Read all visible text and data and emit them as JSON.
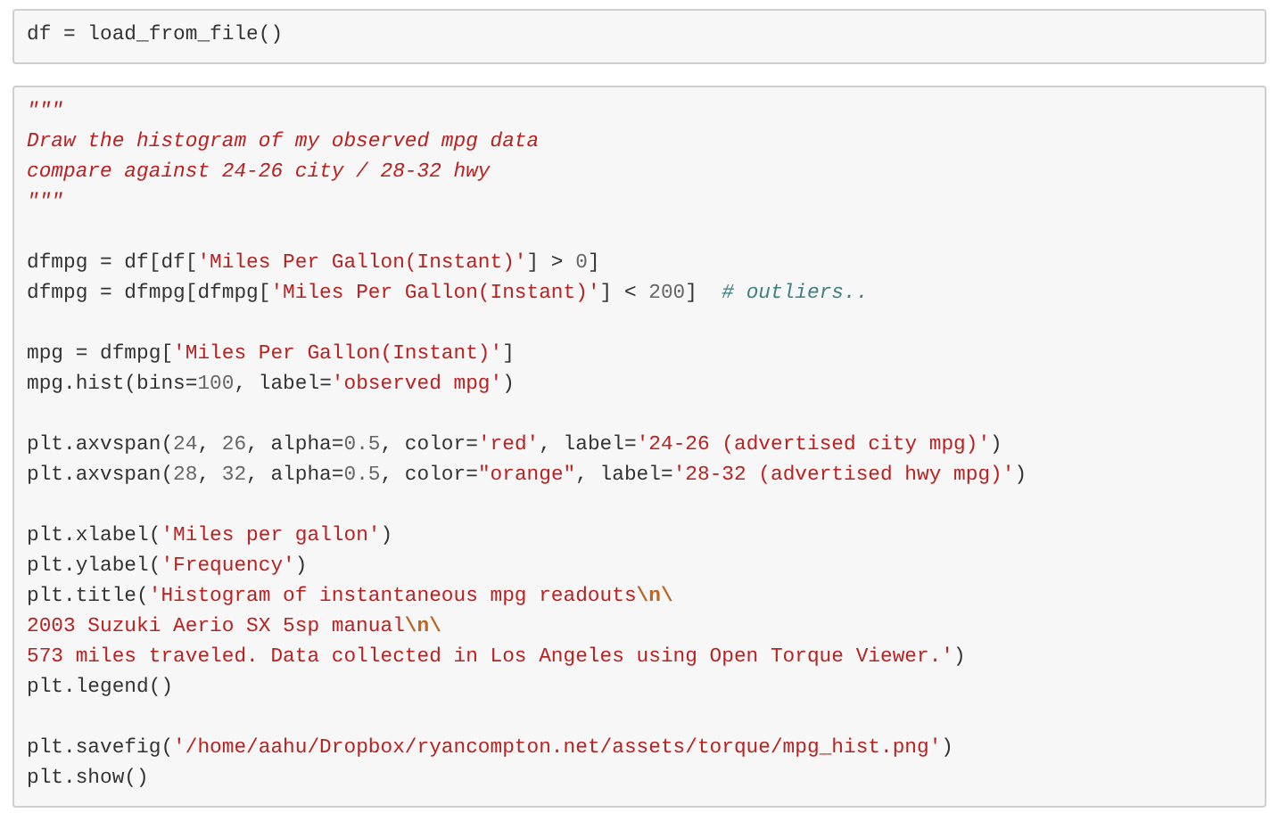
{
  "cells": [
    {
      "lines": [
        {
          "kind": "code",
          "tokens": [
            {
              "kind": "plain",
              "text": "df = load_from_file()"
            }
          ]
        }
      ]
    },
    {
      "lines": [
        {
          "kind": "code",
          "tokens": [
            {
              "kind": "doc",
              "text": "\"\"\""
            }
          ]
        },
        {
          "kind": "code",
          "tokens": [
            {
              "kind": "doc",
              "text": "Draw the histogram of my observed mpg data"
            }
          ]
        },
        {
          "kind": "code",
          "tokens": [
            {
              "kind": "doc",
              "text": "compare against 24-26 city / 28-32 hwy"
            }
          ]
        },
        {
          "kind": "code",
          "tokens": [
            {
              "kind": "doc",
              "text": "\"\"\""
            }
          ]
        },
        {
          "kind": "blank"
        },
        {
          "kind": "code",
          "tokens": [
            {
              "kind": "plain",
              "text": "dfmpg = df[df["
            },
            {
              "kind": "str",
              "text": "'Miles Per Gallon(Instant)'"
            },
            {
              "kind": "plain",
              "text": "] > "
            },
            {
              "kind": "num",
              "text": "0"
            },
            {
              "kind": "plain",
              "text": "]"
            }
          ]
        },
        {
          "kind": "code",
          "tokens": [
            {
              "kind": "plain",
              "text": "dfmpg = dfmpg[dfmpg["
            },
            {
              "kind": "str",
              "text": "'Miles Per Gallon(Instant)'"
            },
            {
              "kind": "plain",
              "text": "] < "
            },
            {
              "kind": "num",
              "text": "200"
            },
            {
              "kind": "plain",
              "text": "]  "
            },
            {
              "kind": "comment",
              "text": "# outliers.."
            }
          ]
        },
        {
          "kind": "blank"
        },
        {
          "kind": "code",
          "tokens": [
            {
              "kind": "plain",
              "text": "mpg = dfmpg["
            },
            {
              "kind": "str",
              "text": "'Miles Per Gallon(Instant)'"
            },
            {
              "kind": "plain",
              "text": "]"
            }
          ]
        },
        {
          "kind": "code",
          "tokens": [
            {
              "kind": "plain",
              "text": "mpg.hist(bins="
            },
            {
              "kind": "num",
              "text": "100"
            },
            {
              "kind": "plain",
              "text": ", label="
            },
            {
              "kind": "str",
              "text": "'observed mpg'"
            },
            {
              "kind": "plain",
              "text": ")"
            }
          ]
        },
        {
          "kind": "blank"
        },
        {
          "kind": "code",
          "tokens": [
            {
              "kind": "plain",
              "text": "plt.axvspan("
            },
            {
              "kind": "num",
              "text": "24"
            },
            {
              "kind": "plain",
              "text": ", "
            },
            {
              "kind": "num",
              "text": "26"
            },
            {
              "kind": "plain",
              "text": ", alpha="
            },
            {
              "kind": "num",
              "text": "0.5"
            },
            {
              "kind": "plain",
              "text": ", color="
            },
            {
              "kind": "str",
              "text": "'red'"
            },
            {
              "kind": "plain",
              "text": ", label="
            },
            {
              "kind": "str",
              "text": "'24-26 (advertised city mpg)'"
            },
            {
              "kind": "plain",
              "text": ")"
            }
          ]
        },
        {
          "kind": "code",
          "tokens": [
            {
              "kind": "plain",
              "text": "plt.axvspan("
            },
            {
              "kind": "num",
              "text": "28"
            },
            {
              "kind": "plain",
              "text": ", "
            },
            {
              "kind": "num",
              "text": "32"
            },
            {
              "kind": "plain",
              "text": ", alpha="
            },
            {
              "kind": "num",
              "text": "0.5"
            },
            {
              "kind": "plain",
              "text": ", color="
            },
            {
              "kind": "str",
              "text": "\"orange\""
            },
            {
              "kind": "plain",
              "text": ", label="
            },
            {
              "kind": "str",
              "text": "'28-32 (advertised hwy mpg)'"
            },
            {
              "kind": "plain",
              "text": ")"
            }
          ]
        },
        {
          "kind": "blank"
        },
        {
          "kind": "code",
          "tokens": [
            {
              "kind": "plain",
              "text": "plt.xlabel("
            },
            {
              "kind": "str",
              "text": "'Miles per gallon'"
            },
            {
              "kind": "plain",
              "text": ")"
            }
          ]
        },
        {
          "kind": "code",
          "tokens": [
            {
              "kind": "plain",
              "text": "plt.ylabel("
            },
            {
              "kind": "str",
              "text": "'Frequency'"
            },
            {
              "kind": "plain",
              "text": ")"
            }
          ]
        },
        {
          "kind": "code",
          "tokens": [
            {
              "kind": "plain",
              "text": "plt.title("
            },
            {
              "kind": "str",
              "text": "'Histogram of instantaneous mpg readouts"
            },
            {
              "kind": "esc",
              "text": "\\n\\"
            }
          ]
        },
        {
          "kind": "code",
          "tokens": [
            {
              "kind": "str",
              "text": "2003 Suzuki Aerio SX 5sp manual"
            },
            {
              "kind": "esc",
              "text": "\\n\\"
            }
          ]
        },
        {
          "kind": "code",
          "tokens": [
            {
              "kind": "str",
              "text": "573 miles traveled. Data collected in Los Angeles using Open Torque Viewer.'"
            },
            {
              "kind": "plain",
              "text": ")"
            }
          ]
        },
        {
          "kind": "code",
          "tokens": [
            {
              "kind": "plain",
              "text": "plt.legend()"
            }
          ]
        },
        {
          "kind": "blank"
        },
        {
          "kind": "code",
          "tokens": [
            {
              "kind": "plain",
              "text": "plt.savefig("
            },
            {
              "kind": "str",
              "text": "'/home/aahu/Dropbox/ryancompton.net/assets/torque/mpg_hist.png'"
            },
            {
              "kind": "plain",
              "text": ")"
            }
          ]
        },
        {
          "kind": "code",
          "tokens": [
            {
              "kind": "plain",
              "text": "plt.show()"
            }
          ]
        }
      ]
    }
  ]
}
